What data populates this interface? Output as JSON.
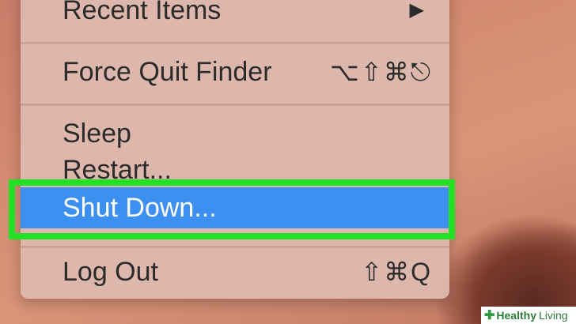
{
  "menu": {
    "recent_items": {
      "label": "Recent Items",
      "arrow": "▶"
    },
    "force_quit": {
      "label": "Force Quit Finder",
      "shortcut": "⌥⇧⌘⎋"
    },
    "sleep": {
      "label": "Sleep"
    },
    "restart": {
      "label": "Restart..."
    },
    "shut_down": {
      "label": "Shut Down..."
    },
    "log_out": {
      "label": "Log Out",
      "shortcut": "⇧⌘Q"
    }
  },
  "watermark": {
    "brand": "Healthy",
    "brand2": "Living"
  },
  "colors": {
    "highlight": "#3d8ff0",
    "annotation_box": "#22e023"
  }
}
